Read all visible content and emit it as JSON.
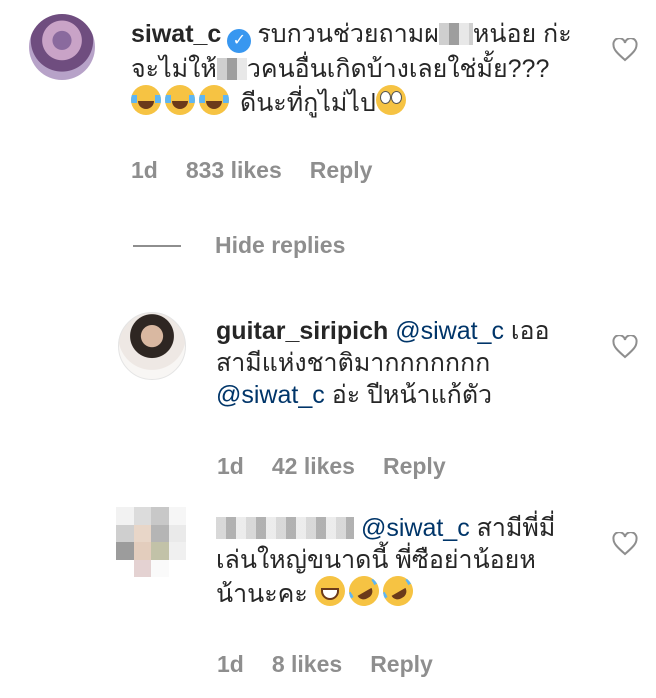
{
  "comments": [
    {
      "username": "siwat_c",
      "verified": true,
      "text_a": "รบกวนช่วยถามผ",
      "text_b": "หน่อย ก่ะ",
      "text_c": "จะไม่ให้",
      "text_d": "วคนอื่นเกิดบ้างเลยใช่มั้ย???",
      "text_e": "ดีนะที่กูไม่ไป",
      "time": "1d",
      "likes": "833 likes",
      "reply": "Reply"
    },
    {
      "username": "guitar_siripich",
      "mention": "@siwat_c",
      "text_a": "เออ",
      "text_b": "สามีแห่งชาติมากกกกกกก",
      "mention2": "@siwat_c",
      "text_c": "อ่ะ ปีหน้าแก้ตัว",
      "time": "1d",
      "likes": "42 likes",
      "reply": "Reply"
    },
    {
      "username_blurred": true,
      "mention": "@siwat_c",
      "text_a": "สามีพี่มี่",
      "text_b": "เล่นใหญ่ขนาดนี้ พี่ซือย่าน้อยห",
      "text_c": "น้านะคะ",
      "time": "1d",
      "likes": "8 likes",
      "reply": "Reply"
    }
  ],
  "hide_replies": "Hide replies",
  "icons": {
    "verified": "verified-badge-icon",
    "like": "heart-outline-icon",
    "emoji_tears": "face-with-tears-of-joy-icon",
    "emoji_eyes": "face-with-rolling-eyes-icon",
    "emoji_grin": "grinning-squinting-face-icon",
    "emoji_rofl": "rolling-on-the-floor-laughing-icon"
  },
  "colors": {
    "text": "#262626",
    "meta": "#8e8e8e",
    "mention": "#003569",
    "verified": "#3897f0"
  }
}
